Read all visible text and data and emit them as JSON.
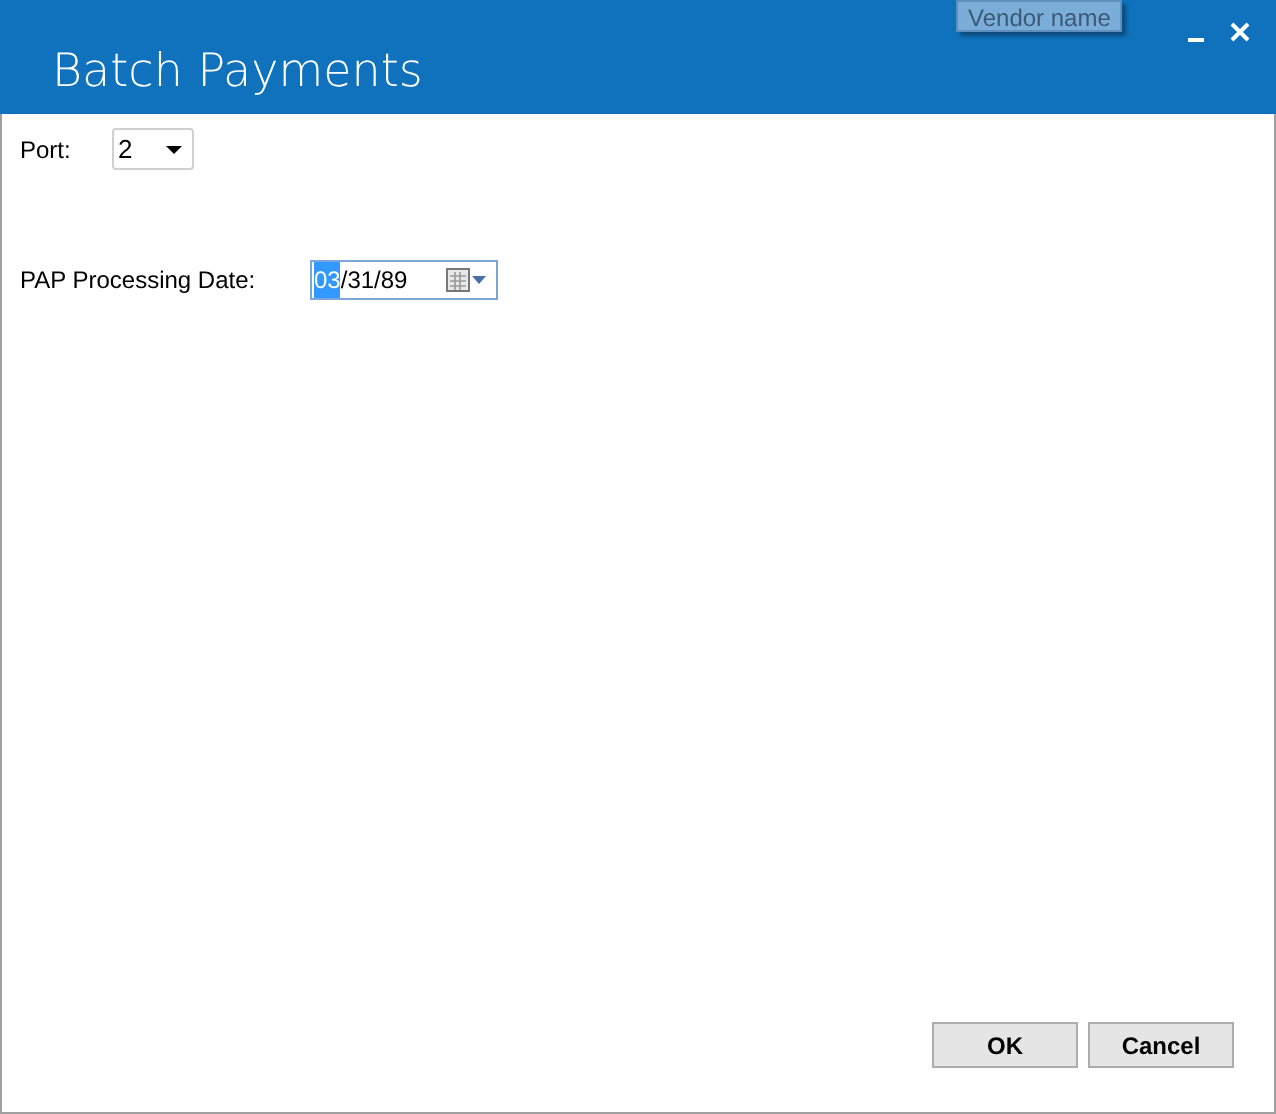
{
  "window": {
    "title": "Batch Payments",
    "tooltip": "Vendor name"
  },
  "port": {
    "label": "Port:",
    "value": "2"
  },
  "processing_date": {
    "label": "PAP Processing Date:",
    "segments": [
      {
        "text": "03",
        "selected": true
      },
      {
        "text": "/31/89",
        "selected": false
      }
    ]
  },
  "buttons": [
    "OK",
    "Cancel"
  ]
}
